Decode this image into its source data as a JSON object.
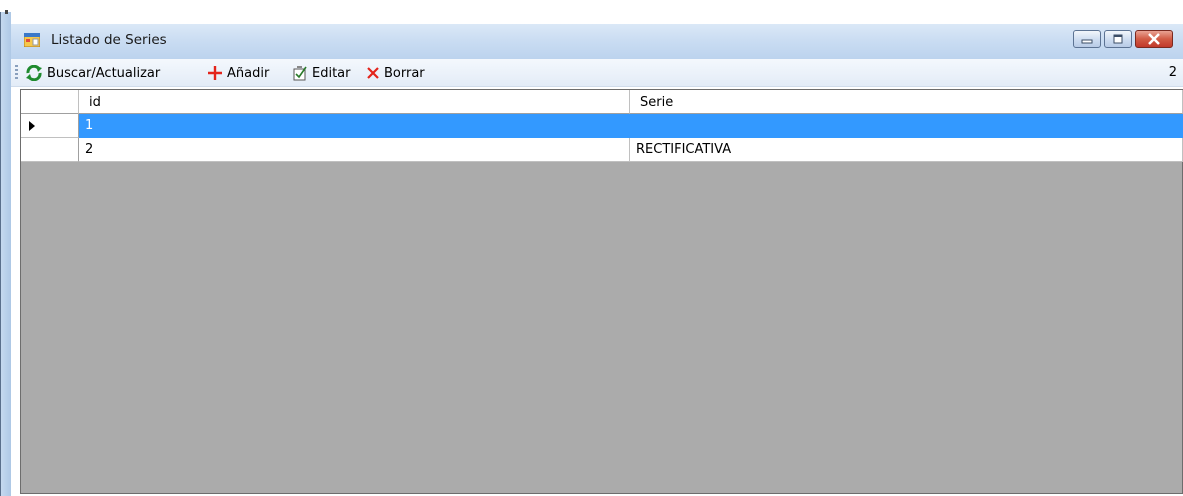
{
  "window": {
    "title": "Listado de Series",
    "icon": "form-icon"
  },
  "toolbar": {
    "buttons": [
      {
        "label": "Buscar/Actualizar",
        "icon": "refresh-icon"
      },
      {
        "label": "Añadir",
        "icon": "plus-icon"
      },
      {
        "label": "Editar",
        "icon": "edit-icon"
      },
      {
        "label": "Borrar",
        "icon": "delete-icon"
      }
    ],
    "count": "2"
  },
  "grid": {
    "columns": [
      "id",
      "Serie"
    ],
    "rows": [
      {
        "id": "1",
        "serie": "",
        "selected": true
      },
      {
        "id": "2",
        "serie": "RECTIFICATIVA",
        "selected": false
      }
    ]
  },
  "colors": {
    "selection": "#3399ff",
    "grid_background": "#ababab",
    "close_button": "#c0392b"
  }
}
